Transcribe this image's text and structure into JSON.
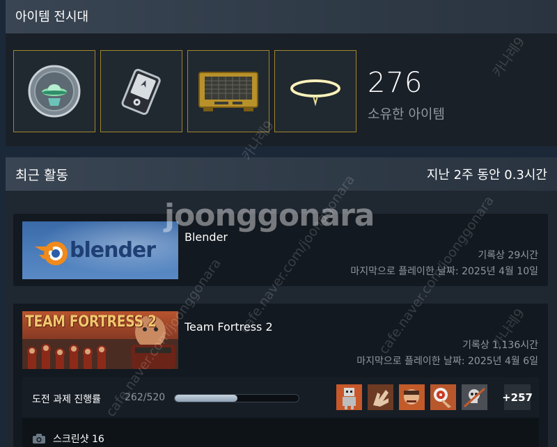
{
  "showcase": {
    "title": "아이템 전시대",
    "count": "276",
    "count_label": "소유한 아이템"
  },
  "recent": {
    "title": "최근 활동",
    "hours": "지난 2주 동안 0.3시간"
  },
  "games": [
    {
      "name": "Blender",
      "capsule_text": "blender",
      "hours": "기록상 29시간",
      "last_played": "마지막으로 플레이한 날짜: 2025년 4월 10일"
    },
    {
      "name": "Team Fortress 2",
      "capsule_text": "TEAM FORTRESS 2",
      "hours": "기록상 1,136시간",
      "last_played": "마지막으로 플레이한 날짜: 2025년 4월 6일",
      "achievements": {
        "label": "도전 과제 진행률",
        "progress": "262/520",
        "fraction": 0.504,
        "more": "+257"
      },
      "screenshots": "스크린샷 16"
    }
  ],
  "watermarks": {
    "brand": "joonggonara",
    "diag_1": "cafe.naver.com/joonggonara",
    "diag_2": "카나레9"
  }
}
